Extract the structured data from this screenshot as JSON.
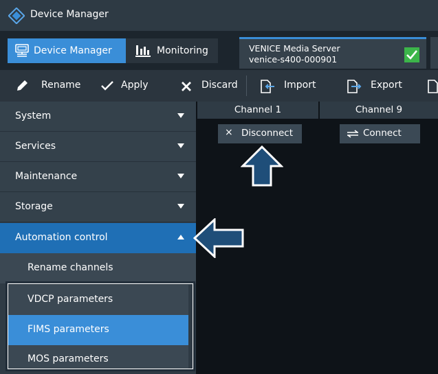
{
  "title_bar": {
    "title": "Device Manager"
  },
  "nav": {
    "device_manager": "Device Manager",
    "monitoring": "Monitoring",
    "server": {
      "name": "VENICE Media Server",
      "host": "venice-s400-000901"
    }
  },
  "toolbar": {
    "rename": "Rename",
    "apply": "Apply",
    "discard": "Discard",
    "import": "Import",
    "export": "Export"
  },
  "sidebar": {
    "items": [
      {
        "label": "System"
      },
      {
        "label": "Services"
      },
      {
        "label": "Maintenance"
      },
      {
        "label": "Storage"
      },
      {
        "label": "Automation control"
      }
    ],
    "subitems": [
      {
        "label": "Rename channels"
      },
      {
        "label": "VDCP parameters"
      },
      {
        "label": "FIMS parameters"
      },
      {
        "label": "MOS parameters"
      }
    ]
  },
  "main": {
    "columns": [
      {
        "header": "Channel 1",
        "action": "Disconnect"
      },
      {
        "header": "Channel 9",
        "action": "Connect"
      }
    ]
  },
  "colors": {
    "accent": "#3a8ed8",
    "selected_item": "#1f6fb5",
    "callout_arrow": "#1f4e79",
    "status_ok": "#3cb54a"
  }
}
